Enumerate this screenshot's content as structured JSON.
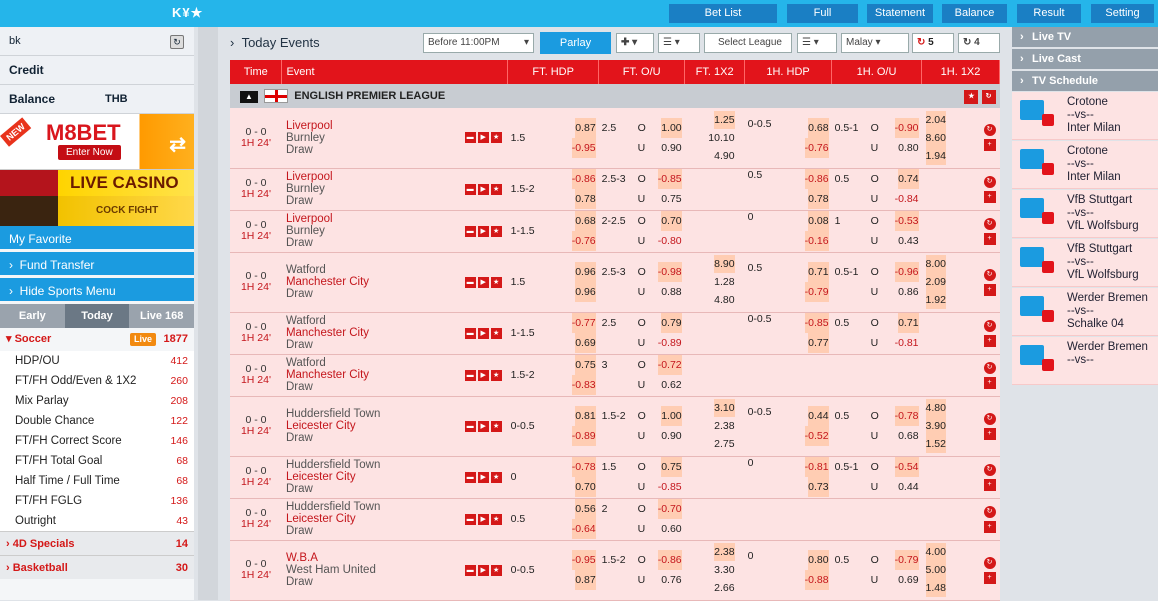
{
  "header": {
    "logo": "K¥★",
    "nav": [
      "Bet List",
      "Full",
      "Statement",
      "Balance",
      "Result",
      "Setting"
    ]
  },
  "left": {
    "user": "bk",
    "credit_label": "Credit",
    "balance_label": "Balance",
    "currency": "THB",
    "banner": {
      "new": "NEW",
      "title": "M8BET",
      "enter": "Enter Now"
    },
    "casino": "LIVE CASINO",
    "cockfight": "COCK FIGHT",
    "favorite": "My Favorite",
    "fund": "Fund Transfer",
    "hide": "Hide Sports Menu",
    "tabs": [
      "Early",
      "Today",
      "Live 168"
    ],
    "soccer": {
      "label": "Soccer",
      "live": "Live",
      "count": "1877"
    },
    "items": [
      {
        "l": "HDP/OU",
        "c": "412"
      },
      {
        "l": "FT/FH Odd/Even & 1X2",
        "c": "260"
      },
      {
        "l": "Mix Parlay",
        "c": "208"
      },
      {
        "l": "Double Chance",
        "c": "122"
      },
      {
        "l": "FT/FH Correct Score",
        "c": "146"
      },
      {
        "l": "FT/FH Total Goal",
        "c": "68"
      },
      {
        "l": "Half Time / Full Time",
        "c": "68"
      },
      {
        "l": "FT/FH FGLG",
        "c": "136"
      },
      {
        "l": "Outright",
        "c": "43"
      }
    ],
    "specials": [
      {
        "l": "4D Specials",
        "c": "14"
      },
      {
        "l": "Basketball",
        "c": "30"
      }
    ]
  },
  "main": {
    "title": "Today Events",
    "time_filter": "Before 11:00PM",
    "parlay": "Parlay",
    "select_league": "Select League",
    "odds_type": "Malay",
    "refresh1": "5",
    "refresh2": "4",
    "columns": [
      "Time",
      "Event",
      "FT. HDP",
      "FT. O/U",
      "FT. 1X2",
      "1H. HDP",
      "1H. O/U",
      "1H. 1X2"
    ],
    "league": "ENGLISH PREMIER LEAGUE"
  },
  "events": [
    {
      "score": "0 - 0",
      "time": "1H 24'",
      "home": "Liverpool",
      "away": "Burnley",
      "draw": "Draw",
      "fav": "home",
      "hdp": "1.5",
      "hdp_h": "0.87",
      "hdp_a": "-0.95",
      "ou": "2.5",
      "ou_o": "1.00",
      "ou_u": "0.90",
      "x1": "1.25",
      "x2": "10.10",
      "xd": "4.90",
      "h_hdp": "0-0.5",
      "h_h": "0.68",
      "h_a": "-0.76",
      "h_ou": "0.5-1",
      "h_o": "-0.90",
      "h_u": "0.80",
      "hx1": "2.04",
      "hx2": "8.60",
      "hxd": "1.94"
    },
    {
      "score": "0 - 0",
      "time": "1H 24'",
      "home": "Liverpool",
      "away": "Burnley",
      "draw": "Draw",
      "fav": "home",
      "hdp": "1.5-2",
      "hdp_h": "-0.86",
      "hdp_a": "0.78",
      "ou": "2.5-3",
      "ou_o": "-0.85",
      "ou_u": "0.75",
      "x1": "",
      "x2": "",
      "xd": "",
      "h_hdp": "0.5",
      "h_h": "-0.86",
      "h_a": "0.78",
      "h_ou": "0.5",
      "h_o": "0.74",
      "h_u": "-0.84",
      "hx1": "",
      "hx2": "",
      "hxd": ""
    },
    {
      "score": "0 - 0",
      "time": "1H 24'",
      "home": "Liverpool",
      "away": "Burnley",
      "draw": "Draw",
      "fav": "home",
      "hdp": "1-1.5",
      "hdp_h": "0.68",
      "hdp_a": "-0.76",
      "ou": "2-2.5",
      "ou_o": "0.70",
      "ou_u": "-0.80",
      "x1": "",
      "x2": "",
      "xd": "",
      "h_hdp": "0",
      "h_h": "0.08",
      "h_a": "-0.16",
      "h_ou": "1",
      "h_o": "-0.53",
      "h_u": "0.43",
      "hx1": "",
      "hx2": "",
      "hxd": ""
    },
    {
      "score": "0 - 0",
      "time": "1H 24'",
      "home": "Watford",
      "away": "Manchester City",
      "draw": "Draw",
      "fav": "away",
      "hdp": "1.5",
      "hdp_h": "0.96",
      "hdp_a": "0.96",
      "ou": "2.5-3",
      "ou_o": "-0.98",
      "ou_u": "0.88",
      "x1": "8.90",
      "x2": "1.28",
      "xd": "4.80",
      "h_hdp": "0.5",
      "h_h": "0.71",
      "h_a": "-0.79",
      "h_ou": "0.5-1",
      "h_o": "-0.96",
      "h_u": "0.86",
      "hx1": "8.00",
      "hx2": "2.09",
      "hxd": "1.92"
    },
    {
      "score": "0 - 0",
      "time": "1H 24'",
      "home": "Watford",
      "away": "Manchester City",
      "draw": "Draw",
      "fav": "away",
      "hdp": "1-1.5",
      "hdp_h": "-0.77",
      "hdp_a": "0.69",
      "ou": "2.5",
      "ou_o": "0.79",
      "ou_u": "-0.89",
      "x1": "",
      "x2": "",
      "xd": "",
      "h_hdp": "0-0.5",
      "h_h": "-0.85",
      "h_a": "0.77",
      "h_ou": "0.5",
      "h_o": "0.71",
      "h_u": "-0.81",
      "hx1": "",
      "hx2": "",
      "hxd": ""
    },
    {
      "score": "0 - 0",
      "time": "1H 24'",
      "home": "Watford",
      "away": "Manchester City",
      "draw": "Draw",
      "fav": "away",
      "hdp": "1.5-2",
      "hdp_h": "0.75",
      "hdp_a": "-0.83",
      "ou": "3",
      "ou_o": "-0.72",
      "ou_u": "0.62",
      "x1": "",
      "x2": "",
      "xd": "",
      "h_hdp": "",
      "h_h": "",
      "h_a": "",
      "h_ou": "",
      "h_o": "",
      "h_u": "",
      "hx1": "",
      "hx2": "",
      "hxd": ""
    },
    {
      "score": "0 - 0",
      "time": "1H 24'",
      "home": "Huddersfield Town",
      "away": "Leicester City",
      "draw": "Draw",
      "fav": "away",
      "hdp": "0-0.5",
      "hdp_h": "0.81",
      "hdp_a": "-0.89",
      "ou": "1.5-2",
      "ou_o": "1.00",
      "ou_u": "0.90",
      "x1": "3.10",
      "x2": "2.38",
      "xd": "2.75",
      "h_hdp": "0-0.5",
      "h_h": "0.44",
      "h_a": "-0.52",
      "h_ou": "0.5",
      "h_o": "-0.78",
      "h_u": "0.68",
      "hx1": "4.80",
      "hx2": "3.90",
      "hxd": "1.52"
    },
    {
      "score": "0 - 0",
      "time": "1H 24'",
      "home": "Huddersfield Town",
      "away": "Leicester City",
      "draw": "Draw",
      "fav": "away",
      "hdp": "0",
      "hdp_h": "-0.78",
      "hdp_a": "0.70",
      "ou": "1.5",
      "ou_o": "0.75",
      "ou_u": "-0.85",
      "x1": "",
      "x2": "",
      "xd": "",
      "h_hdp": "0",
      "h_h": "-0.81",
      "h_a": "0.73",
      "h_ou": "0.5-1",
      "h_o": "-0.54",
      "h_u": "0.44",
      "hx1": "",
      "hx2": "",
      "hxd": ""
    },
    {
      "score": "0 - 0",
      "time": "1H 24'",
      "home": "Huddersfield Town",
      "away": "Leicester City",
      "draw": "Draw",
      "fav": "away",
      "hdp": "0.5",
      "hdp_h": "0.56",
      "hdp_a": "-0.64",
      "ou": "2",
      "ou_o": "-0.70",
      "ou_u": "0.60",
      "x1": "",
      "x2": "",
      "xd": "",
      "h_hdp": "",
      "h_h": "",
      "h_a": "",
      "h_ou": "",
      "h_o": "",
      "h_u": "",
      "hx1": "",
      "hx2": "",
      "hxd": ""
    },
    {
      "score": "0 - 0",
      "time": "1H 24'",
      "home": "W.B.A",
      "away": "West Ham United",
      "draw": "Draw",
      "fav": "home",
      "hdp": "0-0.5",
      "hdp_h": "-0.95",
      "hdp_a": "0.87",
      "ou": "1.5-2",
      "ou_o": "-0.86",
      "ou_u": "0.76",
      "x1": "2.38",
      "x2": "3.30",
      "xd": "2.66",
      "h_hdp": "0",
      "h_h": "0.80",
      "h_a": "-0.88",
      "h_ou": "0.5",
      "h_o": "-0.79",
      "h_u": "0.69",
      "hx1": "4.00",
      "hx2": "5.00",
      "hxd": "1.48"
    }
  ],
  "right": {
    "live_tv": "Live TV",
    "live_cast": "Live Cast",
    "tv_schedule": "TV Schedule",
    "schedule": [
      {
        "a": "Crotone",
        "vs": "--vs--",
        "b": "Inter Milan"
      },
      {
        "a": "Crotone",
        "vs": "--vs--",
        "b": "Inter Milan"
      },
      {
        "a": "VfB Stuttgart",
        "vs": "--vs--",
        "b": "VfL Wolfsburg"
      },
      {
        "a": "VfB Stuttgart",
        "vs": "--vs--",
        "b": "VfL Wolfsburg"
      },
      {
        "a": "Werder Bremen",
        "vs": "--vs--",
        "b": "Schalke 04"
      },
      {
        "a": "Werder Bremen",
        "vs": "--vs--",
        "b": ""
      }
    ]
  }
}
